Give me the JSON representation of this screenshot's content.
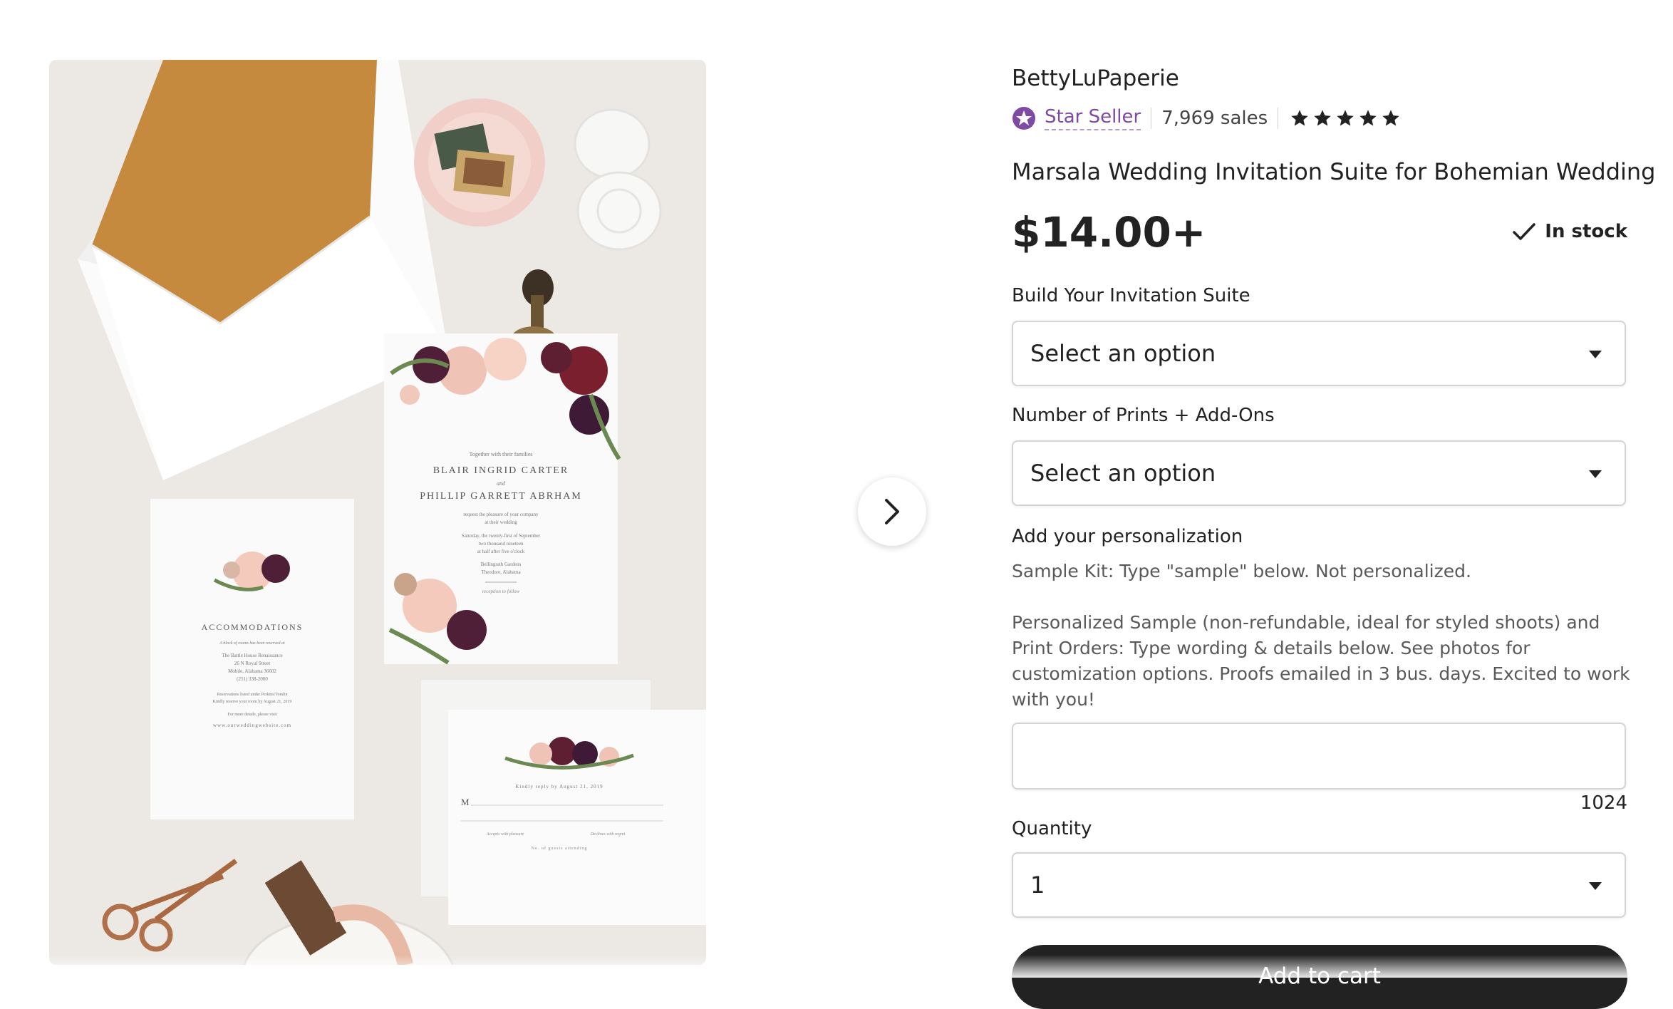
{
  "shop": {
    "name": "BettyLuPaperie",
    "badge_label": "Star Seller",
    "sales": "7,969 sales",
    "rating_stars": 5
  },
  "listing": {
    "title": "Marsala Wedding Invitation Suite for Bohemian Wedding",
    "price": "$14.00+",
    "stock": "In stock"
  },
  "options": {
    "suite_label": "Build Your Invitation Suite",
    "suite_value": "Select an option",
    "prints_label": "Number of Prints + Add-Ons",
    "prints_value": "Select an option"
  },
  "personalization": {
    "label": "Add your personalization",
    "hint_1": "Sample Kit: Type \"sample\" below. Not personalized.",
    "hint_2": "Personalized Sample (non-refundable, ideal for styled shoots) and Print Orders: Type wording & details below. See photos for customization options. Proofs emailed in 3 bus. days. Excited to work with you!",
    "value": "",
    "char_counter": "1024"
  },
  "quantity": {
    "label": "Quantity",
    "value": "1"
  },
  "cart_button": "Add to cart",
  "photo": {
    "invite_line_1": "Together with their families",
    "invite_names_1": "BLAIR INGRID CARTER",
    "invite_and": "and",
    "invite_names_2": "PHILLIP GARRETT ABRHAM",
    "invite_request": "request the pleasure of your company",
    "invite_at": "at their wedding",
    "invite_date_1": "Saturday, the twenty-first of September",
    "invite_date_2": "two thousand nineteen",
    "invite_time": "at half after five o'clock",
    "invite_venue_1": "Bellingrath Gardens",
    "invite_venue_2": "Theodore, Alabama",
    "invite_reception": "reception to follow",
    "acc_title": "ACCOMMODATIONS",
    "acc_line_1": "A block of rooms has been reserved at",
    "acc_line_2": "The Battle House Renaissance",
    "acc_line_3": "26 N Royal Street",
    "acc_line_4": "Mobile, Alabama 36602",
    "acc_line_5": "(251) 338-2000",
    "acc_line_6": "Reservations listed under Perkins/Tomlin",
    "acc_line_7": "Kindly reserve your room by August 21, 2019",
    "acc_line_8": "For more details, please visit",
    "acc_line_9": "www.ourweddingwebsite.com",
    "rsvp_line": "Kindly reply by August 21, 2019",
    "rsvp_m": "M",
    "rsvp_accept": "Accepts with pleasure",
    "rsvp_decline": "Declines with regret",
    "rsvp_guests": "No. of guests attending"
  },
  "colors": {
    "star_seller": "#7f4aa3",
    "cart_button": "#222222",
    "envelope_liner": "#c58a3e",
    "marsala": "#5e1f33"
  }
}
